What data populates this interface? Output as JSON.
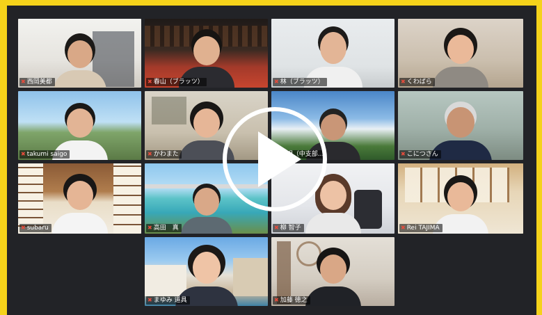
{
  "meeting": {
    "participants": [
      {
        "name": "西岡美都"
      },
      {
        "name": "春山（ブラッツ）"
      },
      {
        "name": "林（ブラッツ）"
      },
      {
        "name": "くわばら"
      },
      {
        "name": "takumi saigo"
      },
      {
        "name": "かわまた"
      },
      {
        "name": "利明（中支部..."
      },
      {
        "name": "こにつさん"
      },
      {
        "name": "subaru"
      },
      {
        "name": "高田　真"
      },
      {
        "name": "柳 智子"
      },
      {
        "name": "Rei TAJIMA"
      },
      {
        "name": "まゆみ 道具"
      },
      {
        "name": "加藤 徳之"
      }
    ],
    "active_speaker": "Rei TAJIMA"
  },
  "colors": {
    "border": "#f5d21a",
    "window": "#222327",
    "active_outline": "#e8d85a",
    "mic_muted": "#e74c3c"
  },
  "controls": {
    "play_icon": "play-icon"
  }
}
